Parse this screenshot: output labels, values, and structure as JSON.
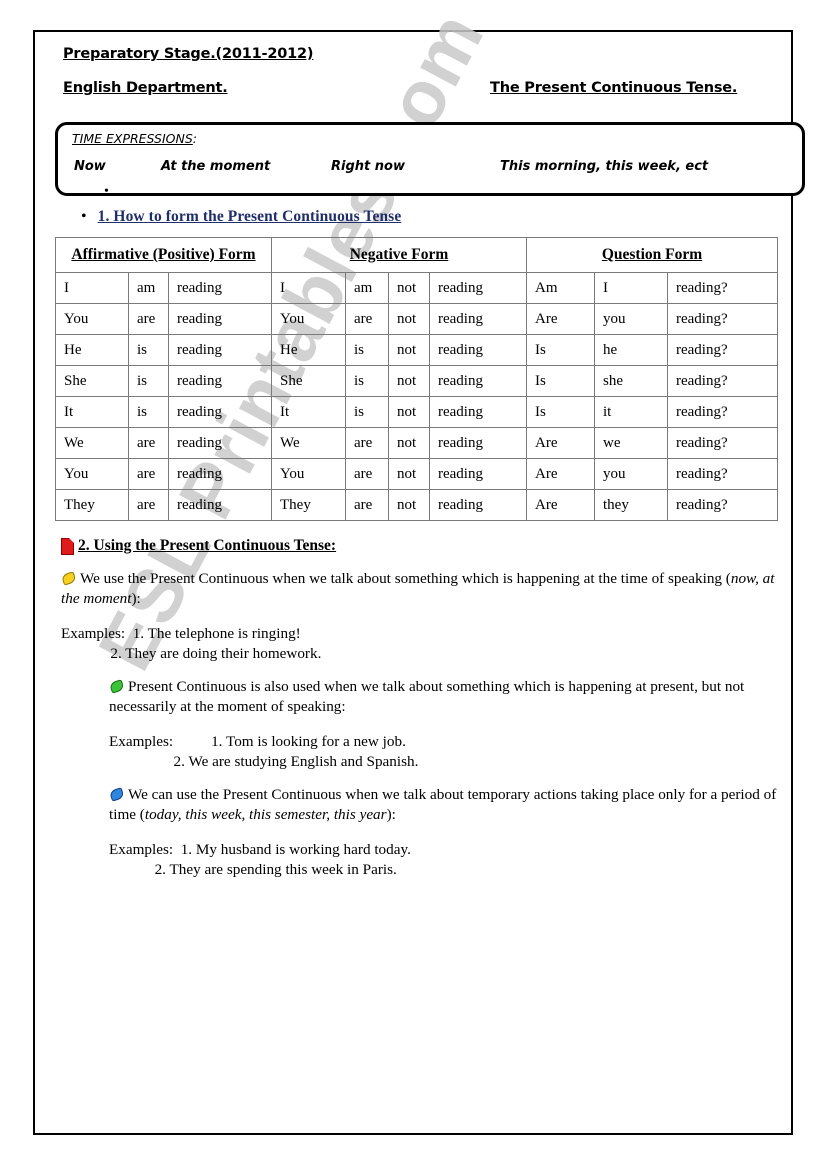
{
  "document": {
    "header": {
      "line1": "Preparatory Stage.(2011-2012)",
      "line2_left": "English Department.",
      "line2_right": "The Present Continuous Tense."
    },
    "time_expressions": {
      "title": "TIME EXPRESSIONS",
      "title_suffix": ":",
      "items": [
        "Now",
        "At the moment",
        "Right now",
        "This morning, this week, ect"
      ],
      "bullet_glyph": "•"
    },
    "section1": {
      "bullet_glyph": "•",
      "heading": "1. How to form the Present Continuous Tense",
      "heading_color": "#1f2d6b",
      "table": {
        "group_headers": [
          "Affirmative (Positive) Form",
          "Negative Form",
          "Question Form"
        ],
        "rows": [
          [
            "I",
            "am",
            "reading",
            "I",
            "am",
            "not",
            "reading",
            "Am",
            "I",
            "reading?"
          ],
          [
            "You",
            "are",
            "reading",
            "You",
            "are",
            "not",
            "reading",
            "Are",
            "you",
            "reading?"
          ],
          [
            "He",
            "is",
            "reading",
            "He",
            "is",
            "not",
            "reading",
            "Is",
            "he",
            "reading?"
          ],
          [
            "She",
            "is",
            "reading",
            "She",
            "is",
            "not",
            "reading",
            "Is",
            "she",
            "reading?"
          ],
          [
            "It",
            "is",
            "reading",
            "It",
            "is",
            "not",
            "reading",
            "Is",
            "it",
            "reading?"
          ],
          [
            "We",
            "are",
            "reading",
            "We",
            "are",
            "not",
            "reading",
            "Are",
            "we",
            "reading?"
          ],
          [
            "You",
            "are",
            "reading",
            "You",
            "are",
            "not",
            "reading",
            "Are",
            "you",
            "reading?"
          ],
          [
            "They",
            "are",
            "reading",
            "They",
            "are",
            "not",
            "reading",
            "Are",
            "they",
            "reading?"
          ]
        ]
      }
    },
    "section2": {
      "icon": "red-page-icon",
      "heading": "2. Using the Present Continuous Tense:",
      "blocks": [
        {
          "bullet_icon": "yellow-gem-icon",
          "bullet_color": "#f5d020",
          "text_before": "We  use the Present Continuous when we talk about something which is happening at the time of speaking (",
          "text_italic": "now, at the moment",
          "text_after": "):",
          "examples_label": "Examples:",
          "examples": [
            "1. The telephone is ringing!",
            "2. They are doing their homework."
          ]
        },
        {
          "bullet_icon": "green-gem-icon",
          "bullet_color": "#3ac43a",
          "text_before": "Present Continuous is also used when we talk about something which is happening at present, but not necessarily at the moment of speaking:",
          "text_italic": "",
          "text_after": "",
          "examples_label": "Examples:",
          "examples": [
            "1. Tom is looking for a new job.",
            "2. We are studying English and Spanish."
          ]
        },
        {
          "bullet_icon": "blue-gem-icon",
          "bullet_color": "#2f86e0",
          "text_before": "We can use the Present Continuous when we talk about temporary actions taking place only for a period of time (",
          "text_italic": "today, this week, this semester, this year",
          "text_after": "):",
          "examples_label": "Examples:",
          "examples": [
            "1. My husband is working hard today.",
            "2. They are spending this week in Paris."
          ]
        }
      ]
    },
    "watermark": {
      "text": "ESL Printables.com",
      "color": "#c9c9c9"
    }
  }
}
